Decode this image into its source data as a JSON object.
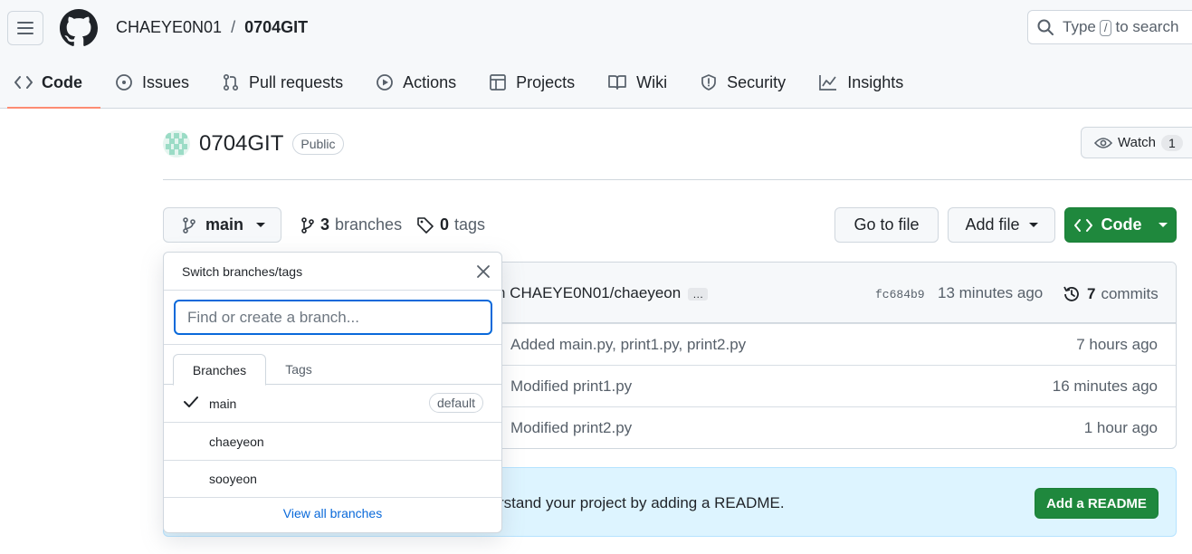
{
  "header": {
    "owner": "CHAEYE0N01",
    "separator": "/",
    "repo": "0704GIT",
    "search": {
      "before": "Type",
      "key": "/",
      "after": "to search"
    }
  },
  "tabs": [
    {
      "label": "Code",
      "icon": "code-icon",
      "selected": true
    },
    {
      "label": "Issues",
      "icon": "issue-icon"
    },
    {
      "label": "Pull requests",
      "icon": "pull-request-icon"
    },
    {
      "label": "Actions",
      "icon": "play-icon"
    },
    {
      "label": "Projects",
      "icon": "table-icon"
    },
    {
      "label": "Wiki",
      "icon": "book-icon"
    },
    {
      "label": "Security",
      "icon": "shield-icon"
    },
    {
      "label": "Insights",
      "icon": "graph-icon"
    }
  ],
  "repo_header": {
    "name": "0704GIT",
    "visibility": "Public",
    "watch_label": "Watch",
    "watch_count": "1"
  },
  "branch_bar": {
    "current_branch": "main",
    "branches_count": "3",
    "branches_label": "branches",
    "tags_count": "0",
    "tags_label": "tags",
    "go_to_file": "Go to file",
    "add_file": "Add file",
    "code": "Code"
  },
  "latest_commit": {
    "author_partial": "n CHAEYE0N01/chaeyeon",
    "ellipsis": "…",
    "sha": "fc684b9",
    "time": "13 minutes ago",
    "commits_count": "7",
    "commits_label": "commits"
  },
  "file_rows": [
    {
      "message": "Added main.py, print1.py, print2.py",
      "time": "7 hours ago"
    },
    {
      "message": "Modified print1.py",
      "time": "16 minutes ago"
    },
    {
      "message": "Modified print2.py",
      "time": "1 hour ago"
    }
  ],
  "readme": {
    "text": "rstand your project by adding a README.",
    "button": "Add a README"
  },
  "dropdown": {
    "title": "Switch branches/tags",
    "search_placeholder": "Find or create a branch...",
    "tabs": [
      "Branches",
      "Tags"
    ],
    "branches": [
      {
        "name": "main",
        "selected": true,
        "badge": "default"
      },
      {
        "name": "chaeyeon"
      },
      {
        "name": "sooyeon"
      }
    ],
    "view_all": "View all branches"
  },
  "colors": {
    "accent_green": "#1f883d",
    "link_blue": "#0969da",
    "tab_underline": "#fd8c73",
    "header_bg": "#f6f8fa",
    "readme_bg": "#ddf4ff"
  }
}
